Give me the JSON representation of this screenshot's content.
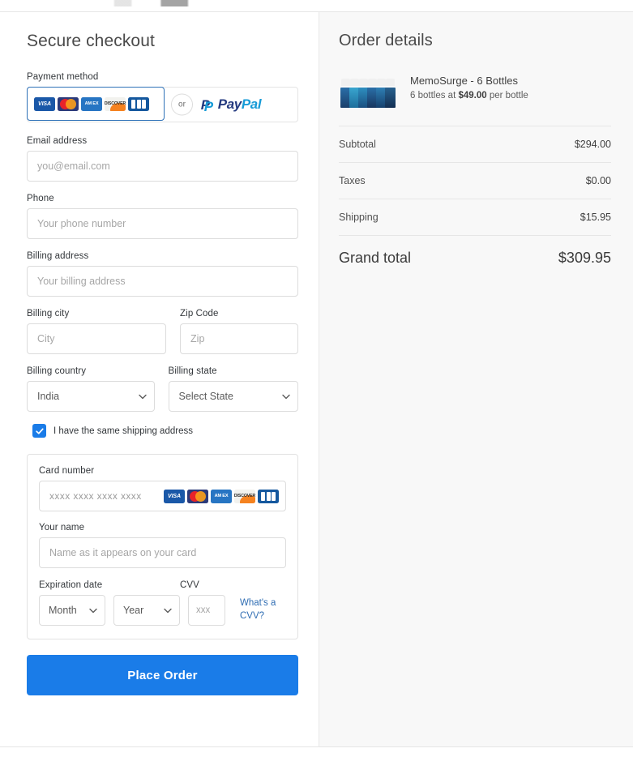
{
  "checkout": {
    "title": "Secure checkout",
    "payment_method": {
      "label": "Payment method",
      "or_text": "or",
      "card_brands": [
        "VISA",
        "Mastercard",
        "AM EX",
        "DISCOVER",
        "JCB"
      ],
      "visa_text": "VISA",
      "amex_text": "AM EX",
      "discover_text": "DISCOVER",
      "paypal_pay": "Pay",
      "paypal_pal": "Pal"
    },
    "email": {
      "label": "Email address",
      "placeholder": "you@email.com",
      "value": ""
    },
    "phone": {
      "label": "Phone",
      "placeholder": "Your phone number",
      "value": ""
    },
    "billing_address": {
      "label": "Billing address",
      "placeholder": "Your billing address",
      "value": ""
    },
    "billing_city": {
      "label": "Billing city",
      "placeholder": "City",
      "value": ""
    },
    "zip_code": {
      "label": "Zip Code",
      "placeholder": "Zip",
      "value": ""
    },
    "billing_country": {
      "label": "Billing country",
      "selected": "India"
    },
    "billing_state": {
      "label": "Billing state",
      "selected": "Select State"
    },
    "same_shipping": {
      "label": "I have the same shipping address",
      "checked": true
    },
    "card": {
      "number_label": "Card number",
      "number_placeholder": "xxxx xxxx xxxx xxxx",
      "name_label": "Your name",
      "name_placeholder": "Name as it appears on your card",
      "expiration_label": "Expiration date",
      "month_selected": "Month",
      "year_selected": "Year",
      "cvv_label": "CVV",
      "cvv_placeholder": "xxx",
      "cvv_help_link": "What's a CVV?"
    },
    "place_order_label": "Place Order"
  },
  "order": {
    "title": "Order details",
    "product": {
      "name": "MemoSurge - 6 Bottles",
      "detail_prefix": "6 bottles at ",
      "detail_price": "$49.00",
      "detail_suffix": " per bottle"
    },
    "summary": [
      {
        "label": "Subtotal",
        "value": "$294.00"
      },
      {
        "label": "Taxes",
        "value": "$0.00"
      },
      {
        "label": "Shipping",
        "value": "$15.95"
      }
    ],
    "grand_total": {
      "label": "Grand total",
      "value": "$309.95"
    }
  },
  "colors": {
    "accent_blue": "#1a7ce8",
    "link_blue": "#2f6db3",
    "selected_border": "#2f72b8",
    "panel_bg": "#f8f8f8"
  }
}
